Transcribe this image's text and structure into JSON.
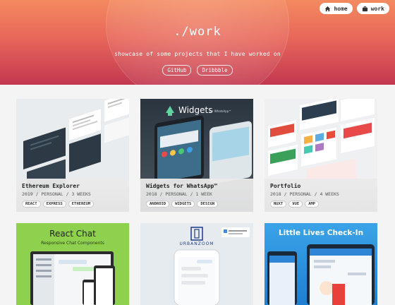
{
  "nav": {
    "home_label": "home",
    "work_label": "work"
  },
  "hero": {
    "title": "./work",
    "subtitle": "showcase of some projects that I have worked on",
    "links": [
      "GitHub",
      "Dribbble"
    ]
  },
  "projects": [
    {
      "name": "Ethereum Explorer",
      "meta": "2019 / PERSONAL / 3 WEEKS",
      "tags": [
        "REACT",
        "EXPRESS",
        "ETHEREUM"
      ]
    },
    {
      "name": "Widgets for WhatsApp™",
      "meta": "2018 / PERSONAL / 1 WEEK",
      "tags": [
        "ANDROID",
        "WIDGETS",
        "DESIGN"
      ],
      "thumb_title": "Widgets",
      "thumb_sub": "for WhatsApp™"
    },
    {
      "name": "Portfolio",
      "meta": "2018 / PERSONAL / 4 WEEKS",
      "tags": [
        "NUXT",
        "VUE",
        "AMP"
      ]
    },
    {
      "name": "React Chat",
      "thumb_title": "React Chat",
      "thumb_sub": "Responsive Chat Components"
    },
    {
      "name": "Urbanzoom",
      "thumb_title": "URBANZOOM"
    },
    {
      "name": "Little Lives Check-In",
      "thumb_title": "Little Lives Check-In"
    }
  ]
}
